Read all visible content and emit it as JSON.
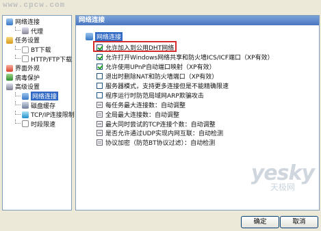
{
  "watermark_top": "www.cpcw.com",
  "watermark_bottom": {
    "big": "yesky",
    "small": "天极网"
  },
  "tree": [
    {
      "label": "网络连接",
      "icon": "network-icon",
      "level": 0
    },
    {
      "label": "代理",
      "icon": "proxy-icon",
      "level": 1
    },
    {
      "label": "任务设置",
      "icon": "task-icon",
      "level": 0
    },
    {
      "label": "BT下载",
      "icon": "bt-icon",
      "level": 1
    },
    {
      "label": "HTTP/FTP下载",
      "icon": "http-icon",
      "level": 1
    },
    {
      "label": "界面外观",
      "icon": "appearance-icon",
      "level": 0
    },
    {
      "label": "病毒保护",
      "icon": "shield-icon",
      "level": 0
    },
    {
      "label": "高级设置",
      "icon": "advanced-icon",
      "level": 0
    },
    {
      "label": "网络连接",
      "icon": "network-icon",
      "level": 1,
      "selected": true
    },
    {
      "label": "磁盘缓存",
      "icon": "disk-icon",
      "level": 1
    },
    {
      "label": "TCP/IP连接限制",
      "icon": "tcp-icon",
      "level": 1
    },
    {
      "label": "时段限速",
      "icon": "clock-icon",
      "level": 1
    }
  ],
  "panel": {
    "title": "网络连接",
    "root_label": "网络连接",
    "options": [
      {
        "type": "checkbox",
        "checked": true,
        "label": "允许加入到公用DHT网络"
      },
      {
        "type": "checkbox",
        "checked": true,
        "label": "允许打开Windows网络共享和防火墙ICS/ICF端口（XP有效）"
      },
      {
        "type": "checkbox",
        "checked": true,
        "label": "允许使用UPnP自动端口映射（XP有效）"
      },
      {
        "type": "checkbox",
        "checked": false,
        "label": "退出时删除NAT和防火墙端口（XP有效）"
      },
      {
        "type": "checkbox",
        "checked": false,
        "label": "服务器模式，支持更多连接但是不能精确限速"
      },
      {
        "type": "checkbox",
        "checked": false,
        "label": "程序运行时防范局域网ARP欺骗攻击"
      },
      {
        "type": "setting",
        "label": "每任务最大连接数：自动调整"
      },
      {
        "type": "setting",
        "label": "全局最大连接数：自动调整"
      },
      {
        "type": "setting",
        "label": "最大同时尝试的TCP连接个数：自动调整"
      },
      {
        "type": "setting",
        "label": "是否允许通过UDP实现内网互联：自动检测"
      },
      {
        "type": "setting",
        "label": "协议加密（防范BT协议过滤）：自动检测"
      }
    ]
  },
  "buttons": {
    "ok": "确定",
    "cancel": "取消"
  },
  "colors": {
    "accent": "#316AC5",
    "highlight_frame": "#D42A2A",
    "check": "#21A121"
  }
}
